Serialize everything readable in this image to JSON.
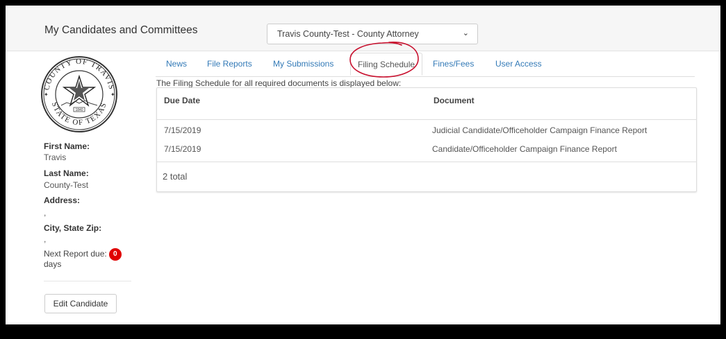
{
  "header": {
    "title": "My Candidates and Committees",
    "candidate_select": "Travis County-Test - County Attorney"
  },
  "sidebar": {
    "seal": {
      "top_text": "COUNTY OF TRAVIS",
      "bottom_text": "STATE OF TEXAS",
      "year": "1840"
    },
    "first_name_label": "First Name:",
    "first_name": "Travis",
    "last_name_label": "Last Name:",
    "last_name": "County-Test",
    "address_label": "Address:",
    "address": ",",
    "city_label": "City, State Zip:",
    "city": ",",
    "next_report_label": "Next Report due:",
    "next_report_days": "0",
    "days_label": "days",
    "edit_button": "Edit Candidate"
  },
  "tabs": [
    {
      "label": "News"
    },
    {
      "label": "File Reports"
    },
    {
      "label": "My Submissions"
    },
    {
      "label": "Filing Schedule",
      "active": true
    },
    {
      "label": "Fines/Fees"
    },
    {
      "label": "User Access"
    }
  ],
  "schedule": {
    "description": "The Filing Schedule for all required documents is displayed below:",
    "columns": [
      "Due Date",
      "Document"
    ],
    "rows": [
      {
        "due_date": "7/15/2019",
        "document": "Judicial Candidate/Officeholder Campaign Finance Report"
      },
      {
        "due_date": "7/15/2019",
        "document": "Candidate/Officeholder Campaign Finance Report"
      }
    ],
    "total": "2 total"
  },
  "colors": {
    "link": "#337ab7",
    "badge": "#e00000",
    "annotation": "#c8102e"
  }
}
